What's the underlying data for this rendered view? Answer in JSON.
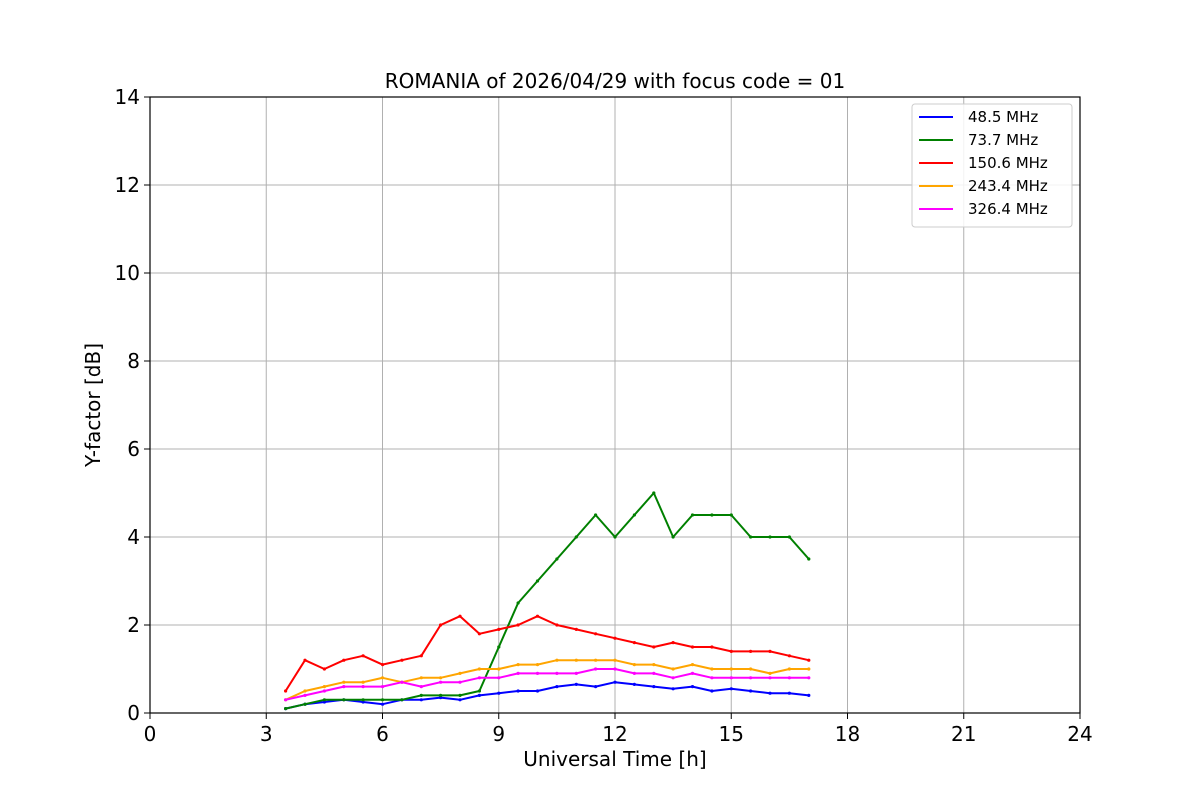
{
  "chart_data": {
    "type": "line",
    "title": "ROMANIA of 2026/04/29 with focus code = 01",
    "xlabel": "Universal Time [h]",
    "ylabel": "Y-factor [dB]",
    "xlim": [
      0,
      24
    ],
    "ylim": [
      0,
      14
    ],
    "xticks": [
      0,
      3,
      6,
      9,
      12,
      15,
      18,
      21,
      24
    ],
    "yticks": [
      0,
      2,
      4,
      6,
      8,
      10,
      12,
      14
    ],
    "xtick_labels": [
      "0",
      "3",
      "6",
      "9",
      "12",
      "15",
      "18",
      "21",
      "24"
    ],
    "ytick_labels": [
      "0",
      "2",
      "4",
      "6",
      "8",
      "10",
      "12",
      "14"
    ],
    "grid": true,
    "legend_position": "top-right",
    "series": [
      {
        "name": " 48.5 MHz",
        "color": "#0000ff",
        "x": [
          3.5,
          4,
          4.5,
          5,
          5.5,
          6,
          6.5,
          7,
          7.5,
          8,
          8.5,
          9,
          9.5,
          10,
          10.5,
          11,
          11.5,
          12,
          12.5,
          13,
          13.5,
          14,
          14.5,
          15,
          15.5,
          16,
          16.5,
          17
        ],
        "y": [
          0.1,
          0.2,
          0.25,
          0.3,
          0.25,
          0.2,
          0.3,
          0.3,
          0.35,
          0.3,
          0.4,
          0.45,
          0.5,
          0.5,
          0.6,
          0.65,
          0.6,
          0.7,
          0.65,
          0.6,
          0.55,
          0.6,
          0.5,
          0.55,
          0.5,
          0.45,
          0.45,
          0.4
        ]
      },
      {
        "name": " 73.7 MHz",
        "color": "#008000",
        "x": [
          3.5,
          4,
          4.5,
          5,
          5.5,
          6,
          6.5,
          7,
          7.5,
          8,
          8.5,
          9,
          9.5,
          10,
          10.5,
          11,
          11.5,
          12,
          12.5,
          13,
          13.5,
          14,
          14.5,
          15,
          15.5,
          16,
          16.5,
          17
        ],
        "y": [
          0.1,
          0.2,
          0.3,
          0.3,
          0.3,
          0.3,
          0.3,
          0.4,
          0.4,
          0.4,
          0.5,
          1.5,
          2.5,
          3.0,
          3.5,
          4.0,
          4.5,
          4.0,
          4.5,
          5.0,
          4.0,
          4.5,
          4.5,
          4.5,
          4.0,
          4.0,
          4.0,
          3.5
        ]
      },
      {
        "name": " 150.6 MHz",
        "color": "#ff0000",
        "x": [
          3.5,
          4,
          4.5,
          5,
          5.5,
          6,
          6.5,
          7,
          7.5,
          8,
          8.5,
          9,
          9.5,
          10,
          10.5,
          11,
          11.5,
          12,
          12.5,
          13,
          13.5,
          14,
          14.5,
          15,
          15.5,
          16,
          16.5,
          17
        ],
        "y": [
          0.5,
          1.2,
          1.0,
          1.2,
          1.3,
          1.1,
          1.2,
          1.3,
          2.0,
          2.2,
          1.8,
          1.9,
          2.0,
          2.2,
          2.0,
          1.9,
          1.8,
          1.7,
          1.6,
          1.5,
          1.6,
          1.5,
          1.5,
          1.4,
          1.4,
          1.4,
          1.3,
          1.2
        ]
      },
      {
        "name": " 243.4 MHz",
        "color": "#ffa500",
        "x": [
          3.5,
          4,
          4.5,
          5,
          5.5,
          6,
          6.5,
          7,
          7.5,
          8,
          8.5,
          9,
          9.5,
          10,
          10.5,
          11,
          11.5,
          12,
          12.5,
          13,
          13.5,
          14,
          14.5,
          15,
          15.5,
          16,
          16.5,
          17
        ],
        "y": [
          0.3,
          0.5,
          0.6,
          0.7,
          0.7,
          0.8,
          0.7,
          0.8,
          0.8,
          0.9,
          1.0,
          1.0,
          1.1,
          1.1,
          1.2,
          1.2,
          1.2,
          1.2,
          1.1,
          1.1,
          1.0,
          1.1,
          1.0,
          1.0,
          1.0,
          0.9,
          1.0,
          1.0
        ]
      },
      {
        "name": " 326.4 MHz",
        "color": "#ff00ff",
        "x": [
          3.5,
          4,
          4.5,
          5,
          5.5,
          6,
          6.5,
          7,
          7.5,
          8,
          8.5,
          9,
          9.5,
          10,
          10.5,
          11,
          11.5,
          12,
          12.5,
          13,
          13.5,
          14,
          14.5,
          15,
          15.5,
          16,
          16.5,
          17
        ],
        "y": [
          0.3,
          0.4,
          0.5,
          0.6,
          0.6,
          0.6,
          0.7,
          0.6,
          0.7,
          0.7,
          0.8,
          0.8,
          0.9,
          0.9,
          0.9,
          0.9,
          1.0,
          1.0,
          0.9,
          0.9,
          0.8,
          0.9,
          0.8,
          0.8,
          0.8,
          0.8,
          0.8,
          0.8
        ]
      }
    ]
  }
}
